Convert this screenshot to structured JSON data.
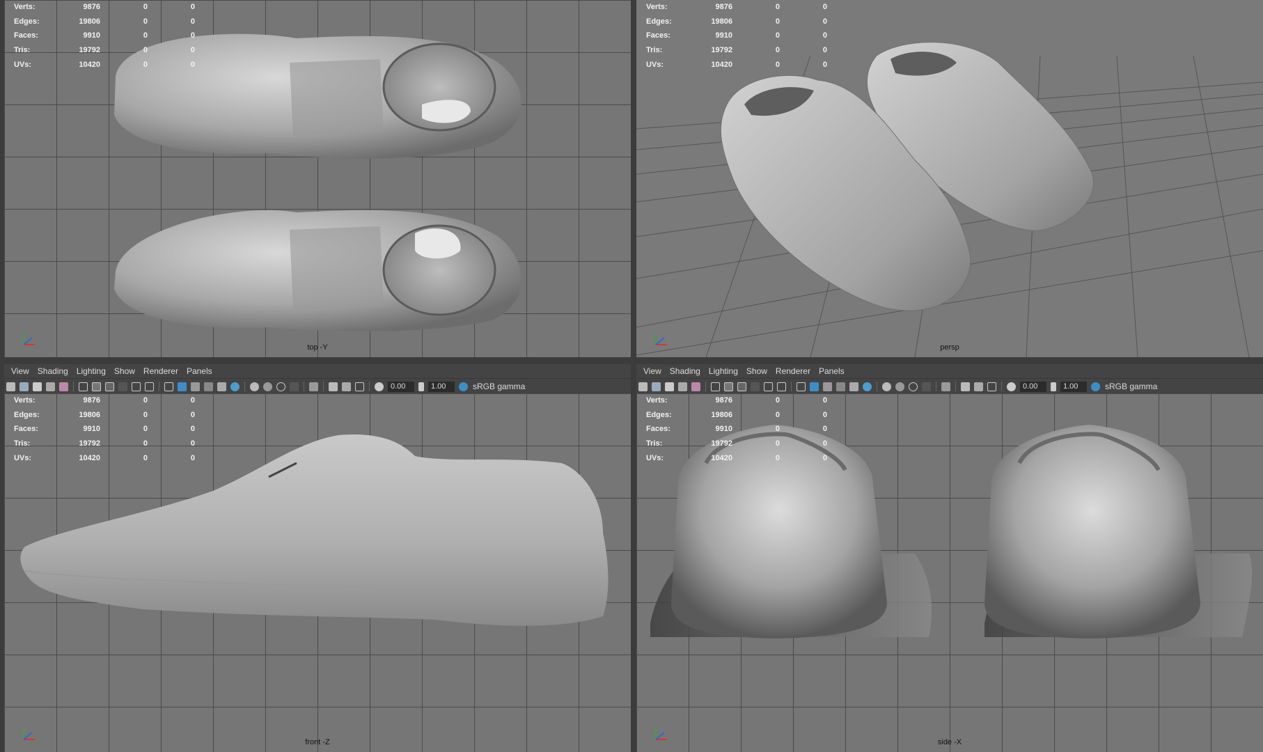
{
  "menu": [
    "View",
    "Shading",
    "Lighting",
    "Show",
    "Renderer",
    "Panels"
  ],
  "toolbar": {
    "exposure": "0.00",
    "gamma": "1.00",
    "color_space": "sRGB gamma"
  },
  "stats": [
    {
      "label": "Verts:",
      "v1": "9876",
      "v2": "0",
      "v3": "0"
    },
    {
      "label": "Edges:",
      "v1": "19806",
      "v2": "0",
      "v3": "0"
    },
    {
      "label": "Faces:",
      "v1": "9910",
      "v2": "0",
      "v3": "0"
    },
    {
      "label": "Tris:",
      "v1": "19792",
      "v2": "0",
      "v3": "0"
    },
    {
      "label": "UVs:",
      "v1": "10420",
      "v2": "0",
      "v3": "0"
    }
  ],
  "viewports": {
    "top": {
      "camera": "top -Y"
    },
    "persp": {
      "camera": "persp"
    },
    "front": {
      "camera": "front -Z"
    },
    "side": {
      "camera": "side -X"
    }
  },
  "colors": {
    "panel_bg": "#444444",
    "grid": "#4a4a4a",
    "viewport": "#767676",
    "accent": "#3a8fc8"
  }
}
